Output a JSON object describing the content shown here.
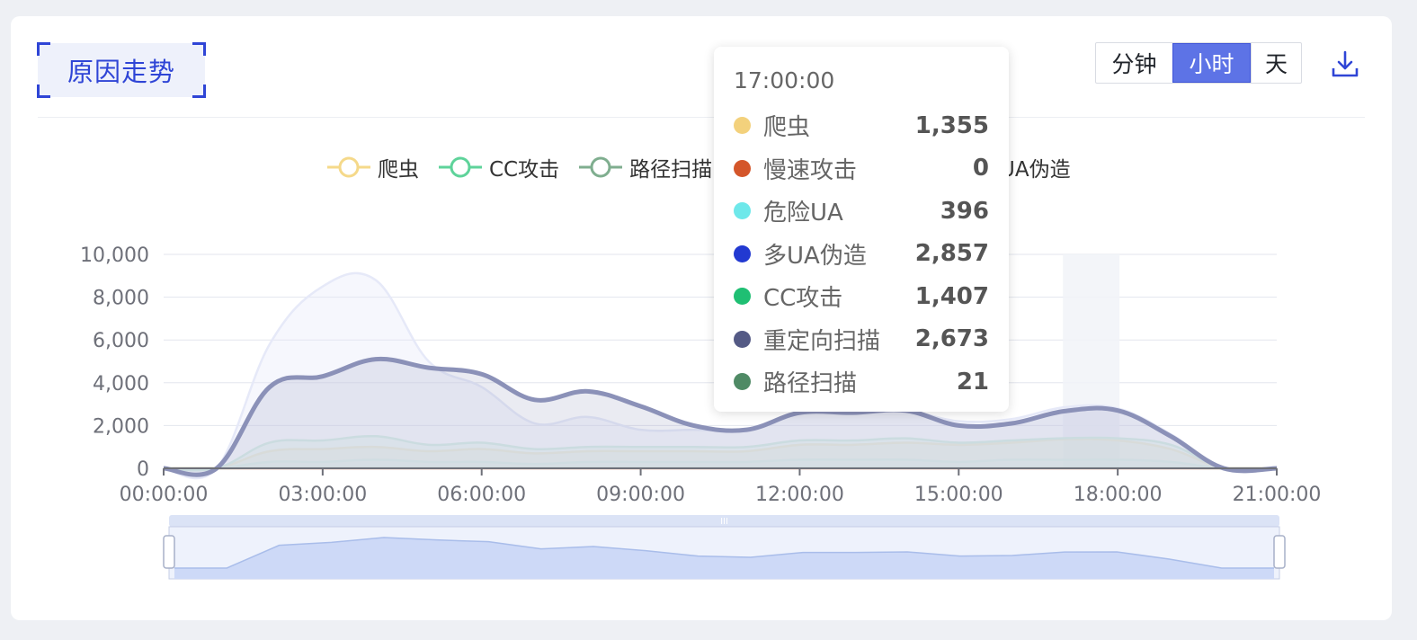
{
  "header": {
    "title": "原因走势",
    "granularity": [
      {
        "label": "分钟",
        "active": false
      },
      {
        "label": "小时",
        "active": true
      },
      {
        "label": "天",
        "active": false
      }
    ],
    "download_icon": "download-icon"
  },
  "legend": [
    {
      "name": "爬虫",
      "color": "#f5d98a"
    },
    {
      "name": "CC攻击",
      "color": "#5ed39a"
    },
    {
      "name": "路径扫描",
      "color": "#7fae8f"
    },
    {
      "name": "UA伪造",
      "color": "#2d3ed6"
    }
  ],
  "tooltip": {
    "time": "17:00:00",
    "rows": [
      {
        "name": "爬虫",
        "value": "1,355",
        "color": "#f3d17c"
      },
      {
        "name": "慢速攻击",
        "value": "0",
        "color": "#d4562a"
      },
      {
        "name": "危险UA",
        "value": "396",
        "color": "#6ee8ea"
      },
      {
        "name": "多UA伪造",
        "value": "2,857",
        "color": "#2239d1"
      },
      {
        "name": "CC攻击",
        "value": "1,407",
        "color": "#1fbf73"
      },
      {
        "name": "重定向扫描",
        "value": "2,673",
        "color": "#545a85"
      },
      {
        "name": "路径扫描",
        "value": "21",
        "color": "#4f8a65"
      }
    ]
  },
  "chart_data": {
    "type": "area",
    "x": [
      "00:00:00",
      "01:00:00",
      "02:00:00",
      "03:00:00",
      "04:00:00",
      "05:00:00",
      "06:00:00",
      "07:00:00",
      "08:00:00",
      "09:00:00",
      "10:00:00",
      "11:00:00",
      "12:00:00",
      "13:00:00",
      "14:00:00",
      "15:00:00",
      "16:00:00",
      "17:00:00",
      "18:00:00",
      "19:00:00",
      "20:00:00",
      "21:00:00"
    ],
    "x_tick_labels": [
      "00:00:00",
      "03:00:00",
      "06:00:00",
      "09:00:00",
      "12:00:00",
      "15:00:00",
      "18:00:00",
      "21:00:00"
    ],
    "ylim": [
      0,
      10000
    ],
    "y_ticks": [
      "0",
      "2,000",
      "4,000",
      "6,000",
      "8,000",
      "10,000"
    ],
    "highlight_x": "17:00:00",
    "grid": true,
    "legend_position": "top-center",
    "series": [
      {
        "name": "重定向扫描",
        "color": "#8b91b8",
        "values": [
          0,
          0,
          3800,
          4300,
          5100,
          4700,
          4400,
          3200,
          3600,
          2900,
          2000,
          1800,
          2600,
          2600,
          2700,
          2000,
          2100,
          2673,
          2700,
          1500,
          0,
          0
        ]
      },
      {
        "name": "多UA伪造",
        "color": "#e6e9f8",
        "values": [
          0,
          0,
          5800,
          8500,
          8800,
          5000,
          3800,
          2100,
          2400,
          1800,
          1800,
          1800,
          2600,
          2600,
          2700,
          2200,
          2300,
          2857,
          2800,
          1600,
          0,
          0
        ]
      },
      {
        "name": "CC攻击",
        "color": "#d4f0e0",
        "values": [
          0,
          0,
          1200,
          1300,
          1500,
          1100,
          1200,
          900,
          1000,
          1000,
          1000,
          1000,
          1300,
          1300,
          1400,
          1200,
          1300,
          1407,
          1400,
          1100,
          0,
          0
        ]
      },
      {
        "name": "爬虫",
        "color": "#f7edd0",
        "values": [
          0,
          0,
          800,
          900,
          1000,
          800,
          900,
          700,
          800,
          800,
          800,
          800,
          1100,
          1100,
          1200,
          1100,
          1200,
          1355,
          1300,
          900,
          0,
          0
        ]
      },
      {
        "name": "危险UA",
        "color": "#d7f5f6",
        "values": [
          0,
          0,
          300,
          300,
          400,
          300,
          300,
          200,
          300,
          300,
          300,
          300,
          400,
          400,
          400,
          300,
          400,
          396,
          400,
          300,
          0,
          0
        ]
      },
      {
        "name": "路径扫描",
        "color": "#b7d3c0",
        "values": [
          0,
          0,
          20,
          20,
          20,
          20,
          20,
          20,
          20,
          20,
          20,
          20,
          20,
          20,
          20,
          20,
          20,
          21,
          20,
          20,
          0,
          0
        ]
      },
      {
        "name": "慢速攻击",
        "color": "#e8a88c",
        "values": [
          0,
          0,
          0,
          0,
          0,
          0,
          0,
          0,
          0,
          0,
          0,
          0,
          0,
          0,
          0,
          0,
          0,
          0,
          0,
          0,
          0,
          0
        ]
      }
    ],
    "overview_values": [
      0,
      0,
      3800,
      4300,
      5100,
      4700,
      4400,
      3200,
      3600,
      2900,
      2000,
      1800,
      2600,
      2600,
      2700,
      2000,
      2100,
      2673,
      2700,
      1500,
      0,
      0
    ]
  }
}
